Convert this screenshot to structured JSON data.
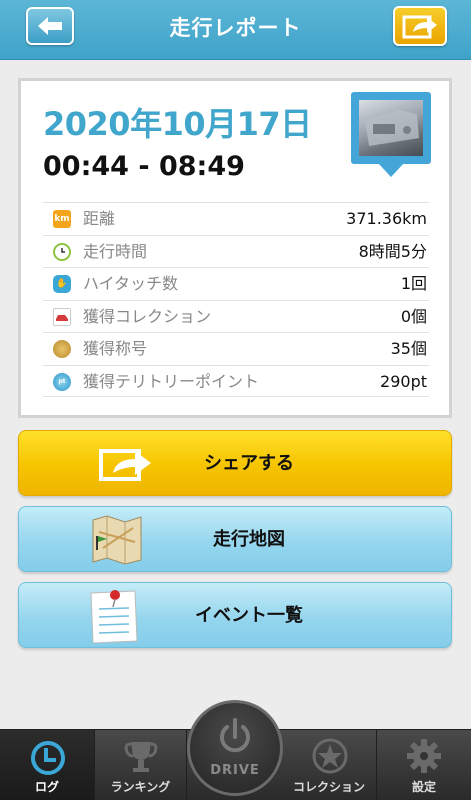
{
  "header": {
    "title": "走行レポート"
  },
  "report": {
    "date": "2020年10月17日",
    "time_range": "00:44 - 08:49",
    "stats": [
      {
        "icon": "km-icon",
        "icon_text": "km",
        "icon_color": "#f4a51a",
        "label": "距離",
        "value": "371.36km"
      },
      {
        "icon": "clock-icon",
        "icon_text": "",
        "icon_color": "#8cc540",
        "label": "走行時間",
        "value": "8時間5分"
      },
      {
        "icon": "high-five-icon",
        "icon_text": "",
        "icon_color": "#3aa7d6",
        "label": "ハイタッチ数",
        "value": "1回"
      },
      {
        "icon": "car-collection-icon",
        "icon_text": "",
        "icon_color": "#d63a3a",
        "label": "獲得コレクション",
        "value": "0個"
      },
      {
        "icon": "title-medal-icon",
        "icon_text": "",
        "icon_color": "#c99a3a",
        "label": "獲得称号",
        "value": "35個"
      },
      {
        "icon": "territory-point-icon",
        "icon_text": "",
        "icon_color": "#3aa7d6",
        "label": "獲得テリトリーポイント",
        "value": "290pt"
      }
    ]
  },
  "actions": {
    "share_label": "シェアする",
    "map_label": "走行地図",
    "events_label": "イベント一覧"
  },
  "tabbar": {
    "log": "ログ",
    "ranking": "ランキング",
    "drive": "DRIVE",
    "collection": "コレクション",
    "settings": "設定"
  },
  "colors": {
    "accent_blue": "#41a6cc",
    "share_yellow": "#f6c400",
    "header_blue": "#4aaed0"
  }
}
